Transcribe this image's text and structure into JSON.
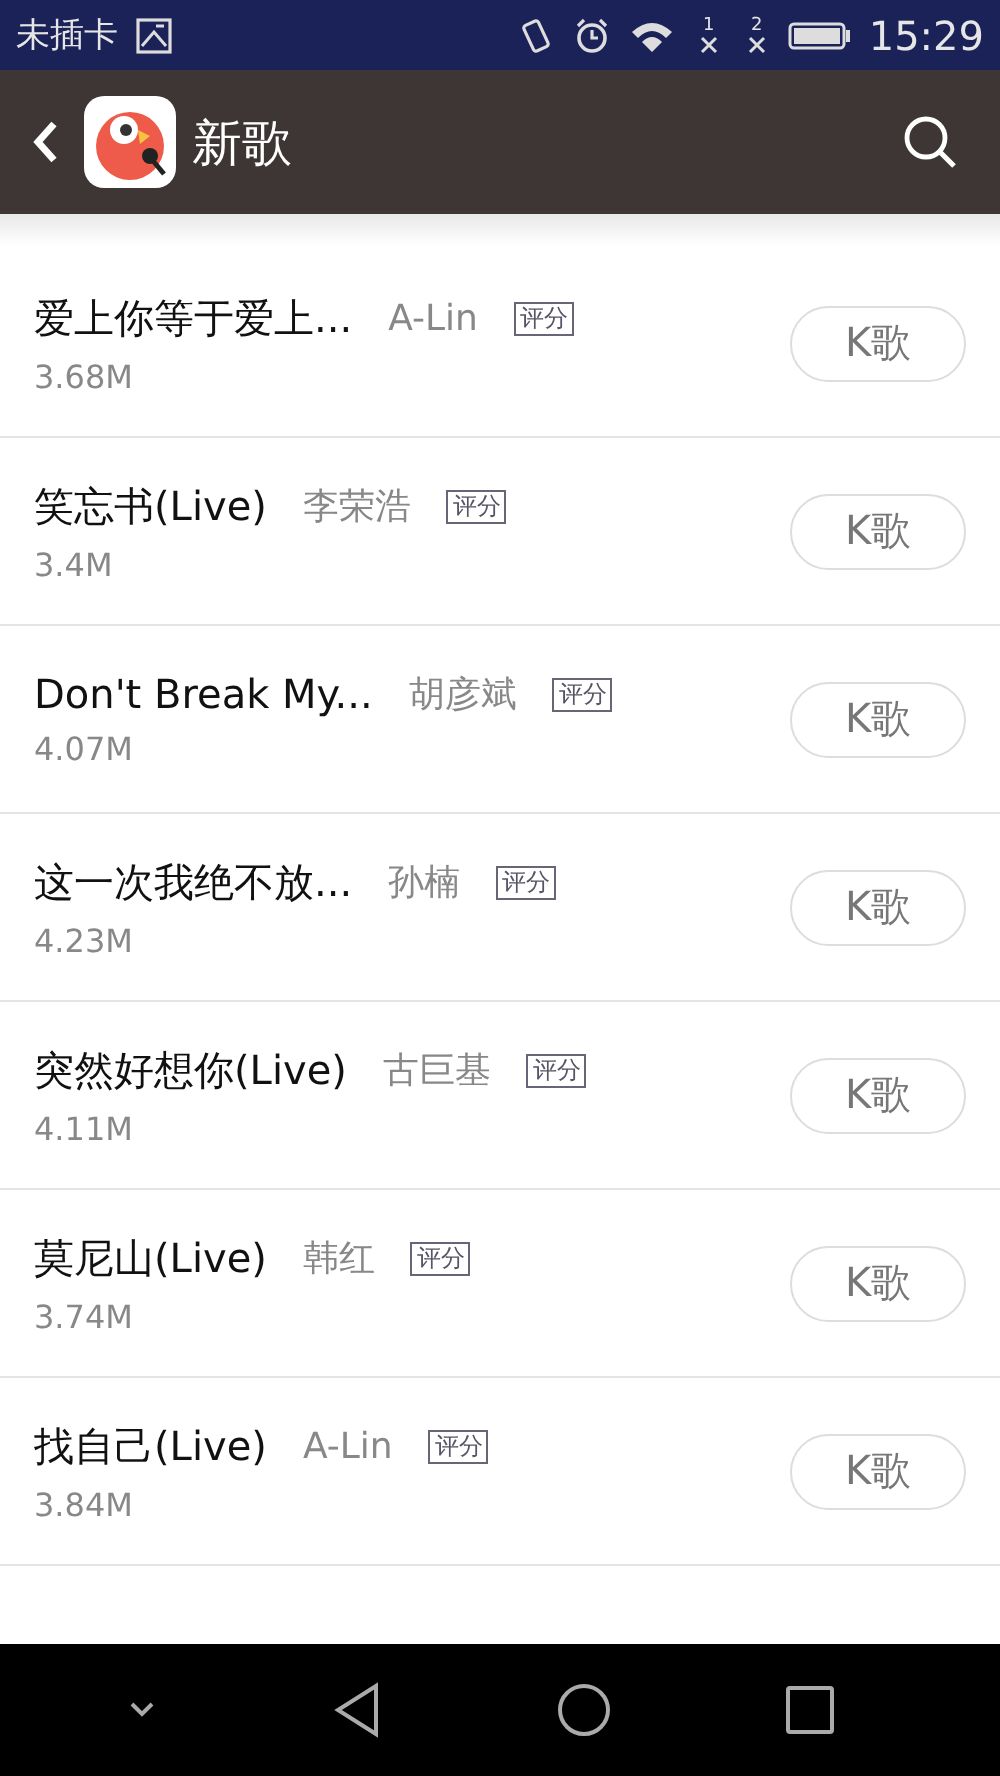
{
  "status_bar": {
    "carrier": "未插卡",
    "sim1": "1",
    "sim2": "2",
    "time": "15:29"
  },
  "header": {
    "title": "新歌"
  },
  "songs": [
    {
      "title": "爱上你等于爱上...",
      "artist": "A-Lin",
      "badge": "评分",
      "size": "3.68M",
      "button": "K歌"
    },
    {
      "title": "笑忘书(Live)",
      "artist": "李荣浩",
      "badge": "评分",
      "size": "3.4M",
      "button": "K歌"
    },
    {
      "title": "Don't Break My...",
      "artist": "胡彦斌",
      "badge": "评分",
      "size": "4.07M",
      "button": "K歌"
    },
    {
      "title": "这一次我绝不放...",
      "artist": "孙楠",
      "badge": "评分",
      "size": "4.23M",
      "button": "K歌"
    },
    {
      "title": "突然好想你(Live)",
      "artist": "古巨基",
      "badge": "评分",
      "size": "4.11M",
      "button": "K歌"
    },
    {
      "title": "莫尼山(Live)",
      "artist": "韩红",
      "badge": "评分",
      "size": "3.74M",
      "button": "K歌"
    },
    {
      "title": "找自己(Live)",
      "artist": "A-Lin",
      "badge": "评分",
      "size": "3.84M",
      "button": "K歌"
    }
  ]
}
